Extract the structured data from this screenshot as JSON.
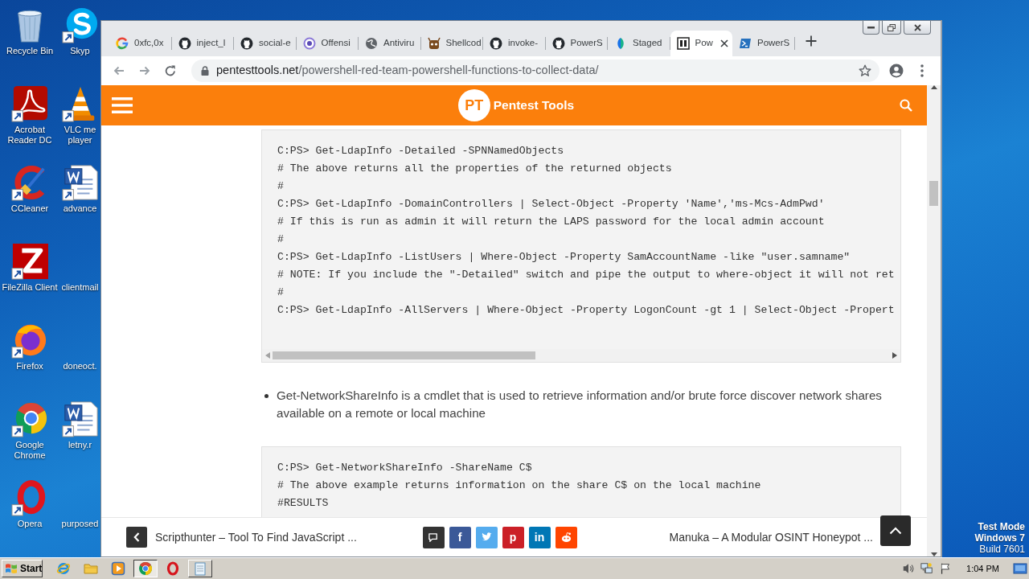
{
  "desktop": {
    "icon_columns": [
      {
        "icons": [
          {
            "label": "Recycle Bin",
            "kind": "recycle-bin"
          },
          {
            "label": "Acrobat Reader DC",
            "kind": "acrobat"
          },
          {
            "label": "CCleaner",
            "kind": "ccleaner"
          },
          {
            "label": "FileZilla Client",
            "kind": "filezilla"
          },
          {
            "label": "Firefox",
            "kind": "firefox"
          },
          {
            "label": "Google Chrome",
            "kind": "chrome"
          },
          {
            "label": "Opera",
            "kind": "opera"
          }
        ]
      },
      {
        "icons": [
          {
            "label": "Skyp",
            "kind": "skype"
          },
          {
            "label": "VLC me player",
            "kind": "vlc"
          },
          {
            "label": "advance",
            "kind": "word"
          },
          {
            "label": "clientmail"
          },
          {
            "label": "doneoct."
          },
          {
            "label": "letny.r",
            "kind": "word"
          },
          {
            "label": "purposed"
          }
        ]
      }
    ],
    "os_notice": {
      "mode": "Test Mode",
      "edition": "Windows 7",
      "build": "Build 7601"
    }
  },
  "browser": {
    "tabs": [
      {
        "title": "0xfc,0x",
        "kind": "google",
        "selected": false
      },
      {
        "title": "inject_l",
        "kind": "github",
        "selected": false
      },
      {
        "title": "social-e",
        "kind": "github",
        "selected": false
      },
      {
        "title": "Offensi",
        "kind": "ring",
        "selected": false
      },
      {
        "title": "Antiviru",
        "kind": "globe",
        "selected": false
      },
      {
        "title": "Shellcod",
        "kind": "mascot",
        "selected": false
      },
      {
        "title": "invoke-",
        "kind": "github",
        "selected": false
      },
      {
        "title": "PowerS",
        "kind": "github",
        "selected": false
      },
      {
        "title": "Staged",
        "kind": "leaf",
        "selected": false
      },
      {
        "title": "Pow",
        "kind": "square",
        "selected": true
      },
      {
        "title": "PowerS",
        "kind": "prompt",
        "selected": false
      }
    ],
    "address_bar": {
      "domain": "pentesttools.net",
      "path": "/powershell-red-team-powershell-functions-to-collect-data/"
    },
    "page": {
      "header": {
        "logo_mark": "PT",
        "logo_text": "Pentest Tools"
      },
      "content": [
        {
          "kind": "code",
          "scrollbar": true,
          "lines": [
            "C:PS> Get-LdapInfo -Detailed -SPNNamedObjects",
            "# The above returns all the properties of the returned objects",
            "#",
            "C:PS> Get-LdapInfo -DomainControllers | Select-Object -Property 'Name','ms-Mcs-AdmPwd'",
            "# If this is run as admin it will return the LAPS password for the local admin account",
            "#",
            "C:PS> Get-LdapInfo -ListUsers | Where-Object -Property SamAccountName -like \"user.samname\"",
            "# NOTE: If you include the \"-Detailed\" switch and pipe the output to where-object it will not ret",
            "#",
            "C:PS> Get-LdapInfo -AllServers | Where-Object -Property LogonCount -gt 1 | Select-Object -Propert"
          ]
        },
        {
          "kind": "bullet",
          "text": "Get-NetworkShareInfo is a cmdlet that is used to retrieve information and/or brute force discover network shares available on a remote or local machine"
        },
        {
          "kind": "code",
          "lines": [
            "C:PS> Get-NetworkShareInfo -ShareName C$",
            "# The above example returns information on the share C$ on the local machine",
            "#RESULTS"
          ]
        }
      ],
      "footer": {
        "previous_post": "Scripthunter – Tool To Find JavaScript ...",
        "share_buttons": [
          {
            "kind": "comment",
            "color": "#333333"
          },
          {
            "kind": "facebook",
            "glyph": "f",
            "color": "#3b5998"
          },
          {
            "kind": "twitter",
            "color": "#55acee"
          },
          {
            "kind": "pinterest",
            "glyph": "p",
            "color": "#cb2027"
          },
          {
            "kind": "linkedin",
            "glyph": "in",
            "color": "#0077b5"
          },
          {
            "kind": "reddit",
            "color": "#ff4500"
          }
        ],
        "next_post": "Manuka – A Modular OSINT Honeypot ..."
      }
    }
  },
  "taskbar": {
    "start_label": "Start",
    "items": [
      {
        "kind": "ie"
      },
      {
        "kind": "folder"
      },
      {
        "kind": "media"
      },
      {
        "kind": "chrome-window",
        "selected": true
      },
      {
        "kind": "opera"
      },
      {
        "kind": "notepad-window",
        "selected": false
      }
    ],
    "clock": "1:04 PM"
  }
}
